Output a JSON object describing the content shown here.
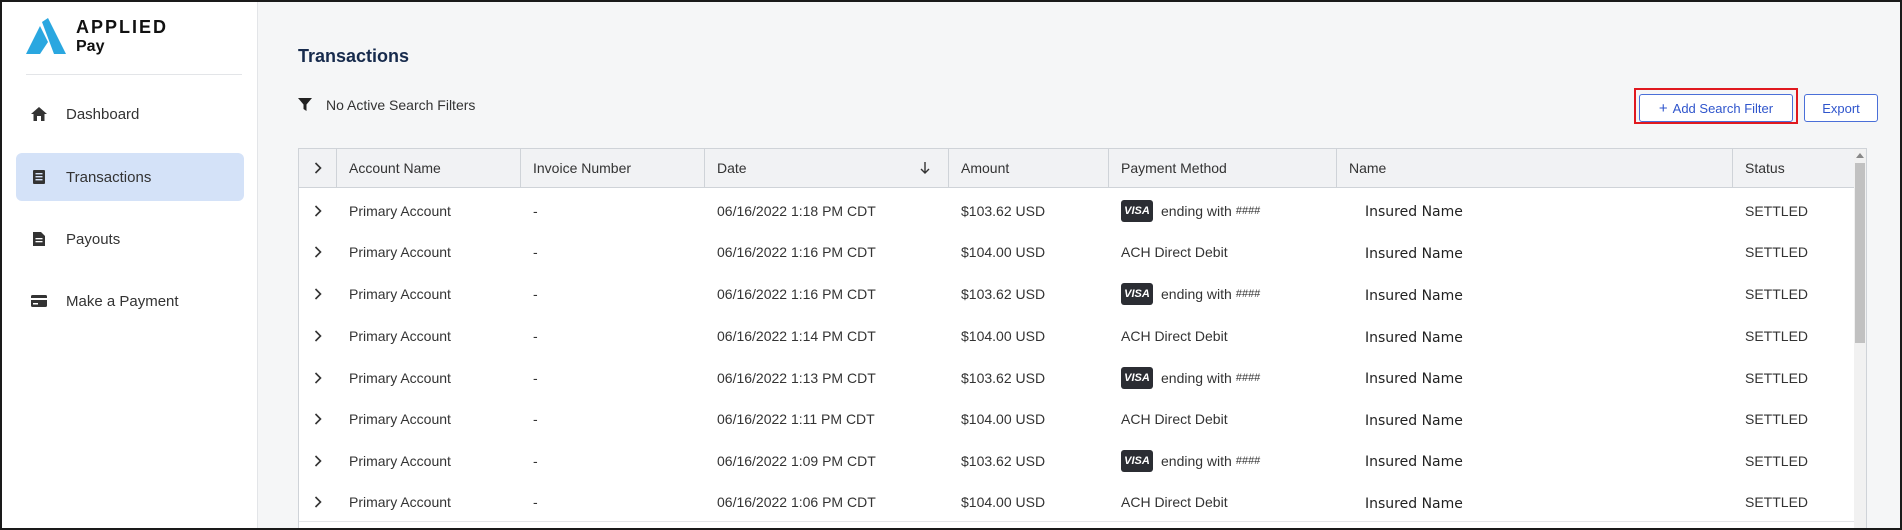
{
  "brand": {
    "line1": "APPLIED",
    "line2": "Pay",
    "logo_color": "#2aa7e0"
  },
  "sidebar": {
    "items": [
      {
        "label": "Dashboard",
        "icon": "home-icon",
        "active": false
      },
      {
        "label": "Transactions",
        "icon": "receipt-icon",
        "active": true
      },
      {
        "label": "Payouts",
        "icon": "document-icon",
        "active": false
      },
      {
        "label": "Make a Payment",
        "icon": "credit-card-icon",
        "active": false
      }
    ]
  },
  "page": {
    "title": "Transactions",
    "filter_status": "No Active Search Filters",
    "add_filter_label": "Add Search Filter",
    "export_label": "Export"
  },
  "table": {
    "columns": [
      "Account Name",
      "Invoice Number",
      "Date",
      "Amount",
      "Payment Method",
      "Name",
      "Status"
    ],
    "sort_column": "Date",
    "sort_direction": "descending",
    "rows": [
      {
        "account": "Primary Account",
        "invoice": "-",
        "date": "06/16/2022 1:18 PM CDT",
        "amount": "$103.62 USD",
        "method_type": "visa",
        "method": "ending with",
        "masked": "####",
        "name": "Insured Name",
        "status": "SETTLED"
      },
      {
        "account": "Primary Account",
        "invoice": "-",
        "date": "06/16/2022 1:16 PM CDT",
        "amount": "$104.00 USD",
        "method_type": "ach",
        "method": "ACH Direct Debit",
        "masked": "",
        "name": "Insured Name",
        "status": "SETTLED"
      },
      {
        "account": "Primary Account",
        "invoice": "-",
        "date": "06/16/2022 1:16 PM CDT",
        "amount": "$103.62 USD",
        "method_type": "visa",
        "method": "ending with",
        "masked": "####",
        "name": "Insured Name",
        "status": "SETTLED"
      },
      {
        "account": "Primary Account",
        "invoice": "-",
        "date": "06/16/2022 1:14 PM CDT",
        "amount": "$104.00 USD",
        "method_type": "ach",
        "method": "ACH Direct Debit",
        "masked": "",
        "name": "Insured Name",
        "status": "SETTLED"
      },
      {
        "account": "Primary Account",
        "invoice": "-",
        "date": "06/16/2022 1:13 PM CDT",
        "amount": "$103.62 USD",
        "method_type": "visa",
        "method": "ending with",
        "masked": "####",
        "name": "Insured Name",
        "status": "SETTLED"
      },
      {
        "account": "Primary Account",
        "invoice": "-",
        "date": "06/16/2022 1:11 PM CDT",
        "amount": "$104.00 USD",
        "method_type": "ach",
        "method": "ACH Direct Debit",
        "masked": "",
        "name": "Insured Name",
        "status": "SETTLED"
      },
      {
        "account": "Primary Account",
        "invoice": "-",
        "date": "06/16/2022 1:09 PM CDT",
        "amount": "$103.62 USD",
        "method_type": "visa",
        "method": "ending with",
        "masked": "####",
        "name": "Insured Name",
        "status": "SETTLED"
      },
      {
        "account": "Primary Account",
        "invoice": "-",
        "date": "06/16/2022 1:06 PM CDT",
        "amount": "$104.00 USD",
        "method_type": "ach",
        "method": "ACH Direct Debit",
        "masked": "",
        "name": "Insured Name",
        "status": "SETTLED"
      }
    ]
  },
  "visa_badge": "VISA"
}
